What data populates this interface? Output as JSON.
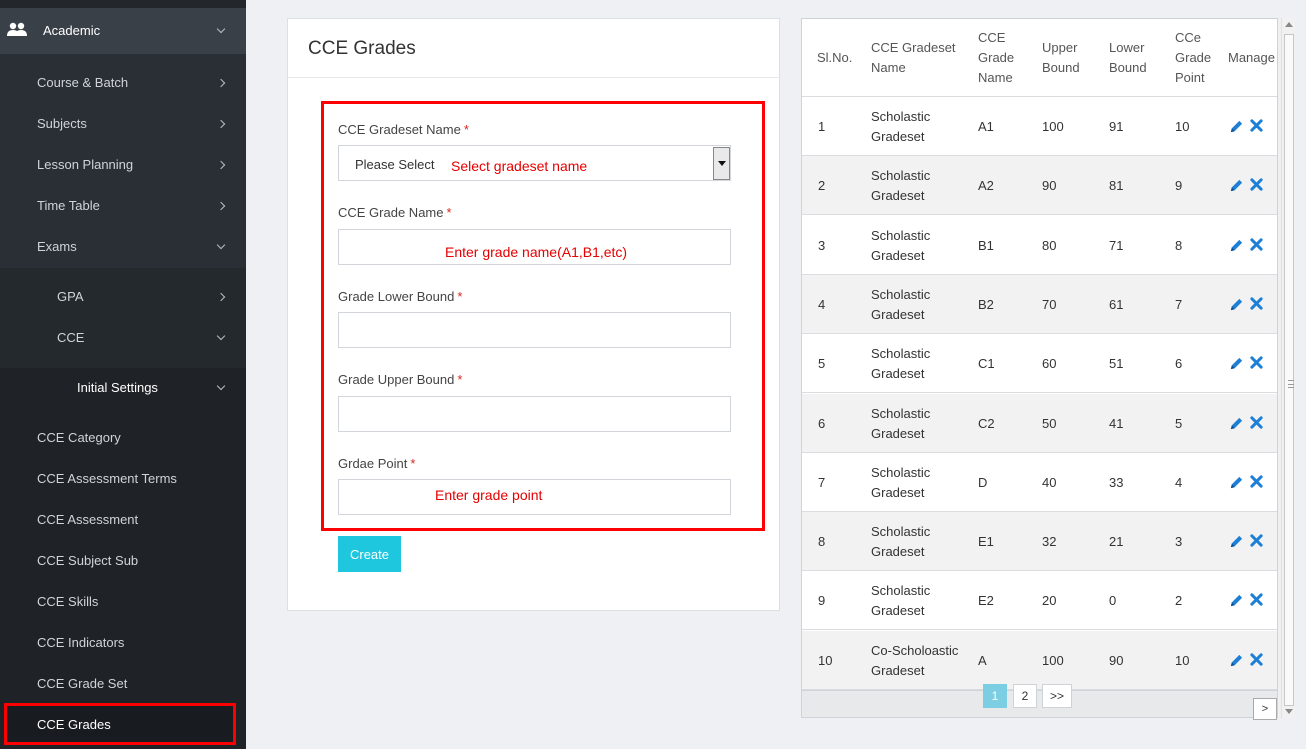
{
  "sidebar": {
    "section": {
      "label": "Academic",
      "icon": "users-icon"
    },
    "items": [
      {
        "label": "Course & Batch"
      },
      {
        "label": "Subjects"
      },
      {
        "label": "Lesson Planning"
      },
      {
        "label": "Time Table"
      },
      {
        "label": "Exams"
      },
      {
        "label": "GPA"
      },
      {
        "label": "CCE"
      },
      {
        "label": "Initial Settings"
      },
      {
        "label": "CCE Category"
      },
      {
        "label": "CCE Assessment Terms"
      },
      {
        "label": "CCE Assessment"
      },
      {
        "label": "CCE Subject Sub"
      },
      {
        "label": "CCE Skills"
      },
      {
        "label": "CCE Indicators"
      },
      {
        "label": "CCE Grade Set"
      },
      {
        "label": "CCE Grades"
      }
    ]
  },
  "form": {
    "title": "CCE Grades",
    "required_mark": "*",
    "gradeset_label": "CCE Gradeset Name",
    "gradeset_select_value": "Please Select",
    "gradeset_hint": "Select gradeset name",
    "grade_name_label": "CCE Grade Name",
    "grade_name_hint": "Enter grade name(A1,B1,etc)",
    "lower_bound_label": "Grade Lower Bound",
    "upper_bound_label": "Grade Upper Bound",
    "grade_point_label": "Grdae Point",
    "grade_point_hint": "Enter grade point",
    "create_label": "Create"
  },
  "table": {
    "headers": {
      "slno": "Sl.No.",
      "gradeset_l1": "CCE Gradeset",
      "gradeset_l2": "Name",
      "grade_l1": "CCE",
      "grade_l2": "Grade",
      "grade_l3": "Name",
      "upper_l1": "Upper",
      "upper_l2": "Bound",
      "lower_l1": "Lower",
      "lower_l2": "Bound",
      "point_l1": "CCe",
      "point_l2": "Grade",
      "point_l3": "Point",
      "manage": "Manage"
    },
    "rows": [
      {
        "slno": "1",
        "set1": "Scholastic",
        "set2": "Gradeset",
        "grade": "A1",
        "upper": "100",
        "lower": "91",
        "point": "10"
      },
      {
        "slno": "2",
        "set1": "Scholastic",
        "set2": "Gradeset",
        "grade": "A2",
        "upper": "90",
        "lower": "81",
        "point": "9"
      },
      {
        "slno": "3",
        "set1": "Scholastic",
        "set2": "Gradeset",
        "grade": "B1",
        "upper": "80",
        "lower": "71",
        "point": "8"
      },
      {
        "slno": "4",
        "set1": "Scholastic",
        "set2": "Gradeset",
        "grade": "B2",
        "upper": "70",
        "lower": "61",
        "point": "7"
      },
      {
        "slno": "5",
        "set1": "Scholastic",
        "set2": "Gradeset",
        "grade": "C1",
        "upper": "60",
        "lower": "51",
        "point": "6"
      },
      {
        "slno": "6",
        "set1": "Scholastic",
        "set2": "Gradeset",
        "grade": "C2",
        "upper": "50",
        "lower": "41",
        "point": "5"
      },
      {
        "slno": "7",
        "set1": "Scholastic",
        "set2": "Gradeset",
        "grade": "D",
        "upper": "40",
        "lower": "33",
        "point": "4"
      },
      {
        "slno": "8",
        "set1": "Scholastic",
        "set2": "Gradeset",
        "grade": "E1",
        "upper": "32",
        "lower": "21",
        "point": "3"
      },
      {
        "slno": "9",
        "set1": "Scholastic",
        "set2": "Gradeset",
        "grade": "E2",
        "upper": "20",
        "lower": "0",
        "point": "2"
      },
      {
        "slno": "10",
        "set1": "Co-Scholoastic",
        "set2": "Gradeset",
        "grade": "A",
        "upper": "100",
        "lower": "90",
        "point": "10"
      }
    ],
    "pagination": {
      "page1": "1",
      "page2": "2",
      "next": ">>",
      "scroll_right": ">"
    },
    "edit_icon": "pencil-icon",
    "delete_icon": "x-icon"
  },
  "colors": {
    "sidebar_bg": "#2a2f35",
    "annotation_red": "#ff0000",
    "create_button": "#1ec6de",
    "edit_icon": "#1e7fd6",
    "pagination_active": "#7ccfe3"
  }
}
